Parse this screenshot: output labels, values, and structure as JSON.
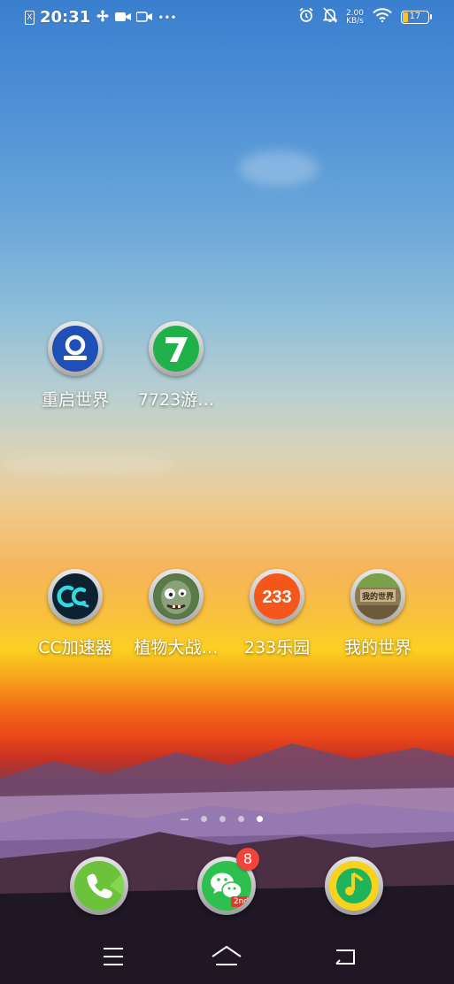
{
  "status_bar": {
    "sim_label": "X",
    "time": "20:31",
    "left_icons": [
      "fan-icon",
      "camera-icon",
      "video-icon",
      "more-dots-icon"
    ],
    "more_dots": "•••",
    "alarm_icon": "alarm-clock-icon",
    "mute_icon": "bell-off-icon",
    "net_speed_value": "2.00",
    "net_speed_unit": "KB/s",
    "wifi_icon": "wifi-icon",
    "battery_level": "17",
    "battery_color": "#f5c338"
  },
  "home": {
    "row1": [
      {
        "label": "重启世界",
        "icon": "reboot-world-icon",
        "color": "#1f4fb3"
      },
      {
        "label": "7723游…",
        "icon": "seven-seven-two-three-icon",
        "color": "#22b24c"
      }
    ],
    "row2": [
      {
        "label": "CC加速器",
        "icon": "cc-accelerator-icon",
        "color": "#0e2634"
      },
      {
        "label": "植物大战…",
        "icon": "zombie-icon",
        "color": "#4d6b3e"
      },
      {
        "label": "233乐园",
        "icon": "two-three-three-icon",
        "color": "#f45a1c",
        "icon_text": "233"
      },
      {
        "label": "我的世界",
        "icon": "minecraft-icon",
        "color": "#7d9b4b",
        "icon_text": "我的世界"
      }
    ]
  },
  "page_indicator": {
    "count": 4,
    "active_index": 3
  },
  "dock": {
    "phone": {
      "icon": "phone-icon",
      "color": "#6dc43c"
    },
    "wechat": {
      "icon": "wechat-icon",
      "color": "#2dbf4f",
      "badge": "8",
      "tag": "2nd"
    },
    "music": {
      "icon": "qq-music-icon",
      "color": "#f7d31d"
    }
  },
  "nav": {
    "menu_icon": "menu-lines-icon",
    "home_icon": "home-icon",
    "back_icon": "back-icon"
  }
}
